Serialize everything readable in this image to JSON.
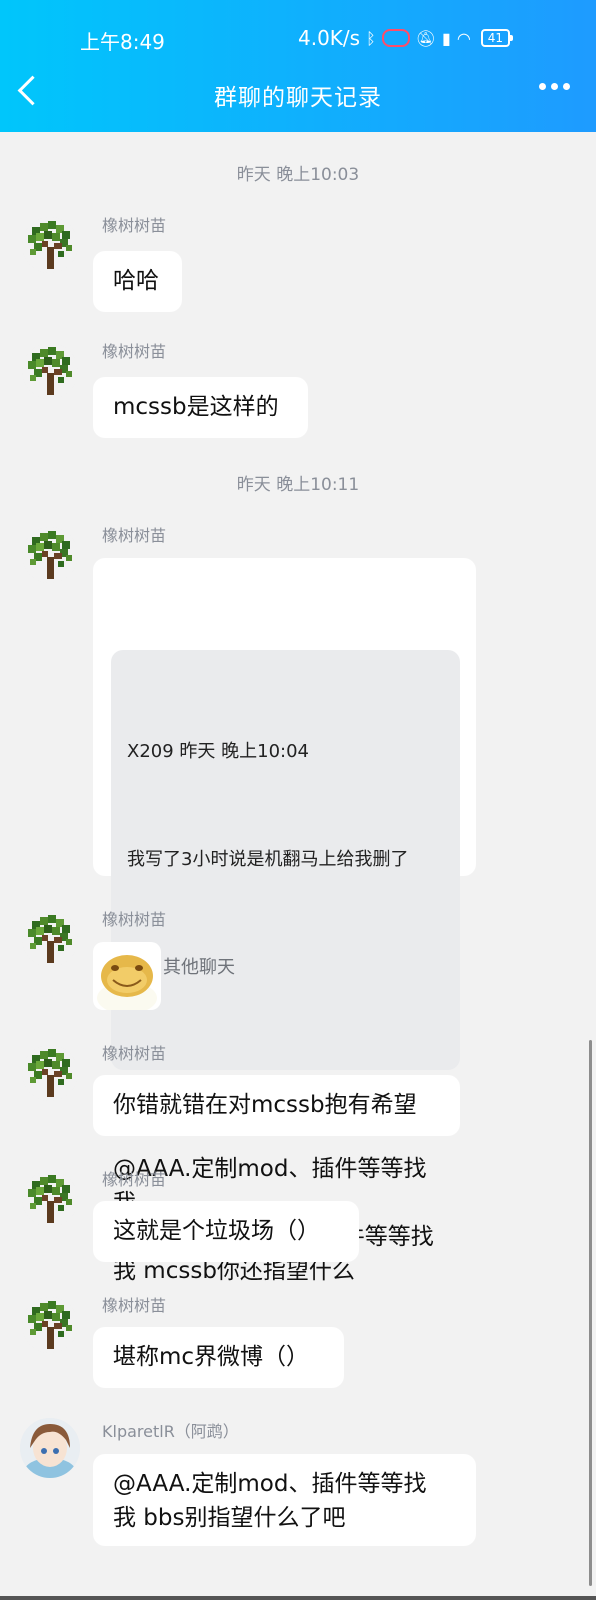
{
  "status_bar": {
    "time": "上午8:49",
    "speed": "4.0K/s",
    "battery": "41"
  },
  "header": {
    "title": "群聊的聊天记录"
  },
  "timestamps": [
    "昨天 晚上10:03",
    "昨天 晚上10:11"
  ],
  "messages": [
    {
      "sender": "橡树树苗",
      "text": "哈哈"
    },
    {
      "sender": "橡树树苗",
      "text": "mcssb是这样的"
    },
    {
      "sender": "橡树树苗",
      "quote": {
        "header": "X209 昨天 晚上10:04",
        "text": "我写了3小时说是机翻马上给我删了",
        "from": "来自其他聊天"
      },
      "text": "@AAA.定制mod、插件等等找\n我\n @AAA.定制mod、插件等等找\n我 mcssb你还指望什么"
    },
    {
      "sender": "橡树树苗",
      "sticker": "frog-sticker"
    },
    {
      "sender": "橡树树苗",
      "text": "你错就错在对mcssb抱有希望"
    },
    {
      "sender": "橡树树苗",
      "text": "这就是个垃圾场（）"
    },
    {
      "sender": "橡树树苗",
      "text": "堪称mc界微博（）"
    },
    {
      "sender": "KlparetlR（阿鹉）",
      "text": "@AAA.定制mod、插件等等找\n我 bbs别指望什么了吧"
    }
  ]
}
